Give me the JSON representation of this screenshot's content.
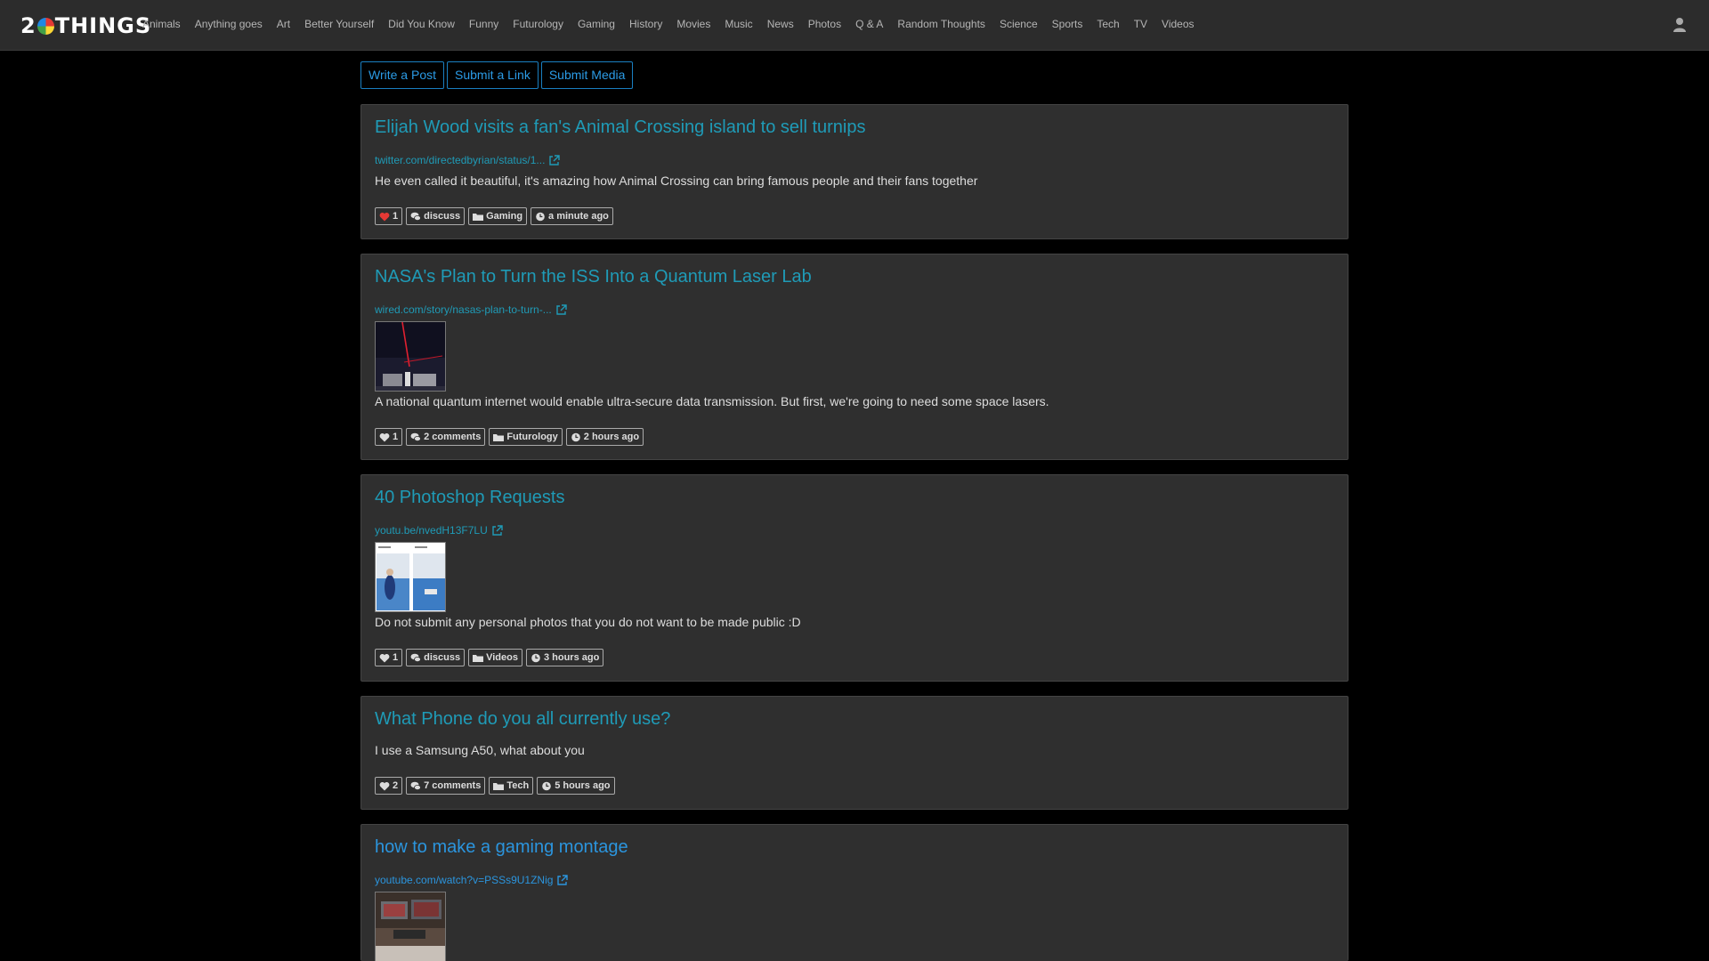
{
  "nav": {
    "logo_text_1": "2",
    "logo_text_2": "THINGS",
    "items": [
      "Animals",
      "Anything goes",
      "Art",
      "Better Yourself",
      "Did You Know",
      "Funny",
      "Futurology",
      "Gaming",
      "History",
      "Movies",
      "Music",
      "News",
      "Photos",
      "Q & A",
      "Random Thoughts",
      "Science",
      "Sports",
      "Tech",
      "TV",
      "Videos"
    ]
  },
  "submit": {
    "write_post": "Write a Post",
    "submit_link": "Submit a Link",
    "submit_media": "Submit Media"
  },
  "posts": [
    {
      "title": "Elijah Wood visits a fan's Animal Crossing island to sell turnips",
      "link": "twitter.com/directedbyrian/status/1...",
      "description": "He even called it beautiful, it's amazing how Animal Crossing can bring famous people and their fans together",
      "likes": "1",
      "liked": true,
      "comments": "discuss",
      "category": "Gaming",
      "time": "a minute ago"
    },
    {
      "title": "NASA's Plan to Turn the ISS Into a Quantum Laser Lab",
      "link": "wired.com/story/nasas-plan-to-turn-...",
      "description": "A national quantum internet would enable ultra-secure data transmission. But first, we're going to need some space lasers.",
      "likes": "1",
      "comments": "2 comments",
      "category": "Futurology",
      "time": "2 hours ago"
    },
    {
      "title": "40 Photoshop Requests",
      "link": "youtu.be/nvedH13F7LU",
      "description": "Do not submit any personal photos that you do not want to be made public :D",
      "likes": "1",
      "comments": "discuss",
      "category": "Videos",
      "time": "3 hours ago"
    },
    {
      "title": "What Phone do you all currently use?",
      "description": "I use a Samsung A50, what about you",
      "likes": "2",
      "comments": "7 comments",
      "category": "Tech",
      "time": "5 hours ago"
    },
    {
      "title": "how to make a gaming montage",
      "link": "youtube.com/watch?v=PSSs9U1ZNig"
    }
  ],
  "colors": {
    "accent_teal": "#1f9bb7",
    "accent_blue": "#2b95de",
    "like_red": "#e53935"
  }
}
